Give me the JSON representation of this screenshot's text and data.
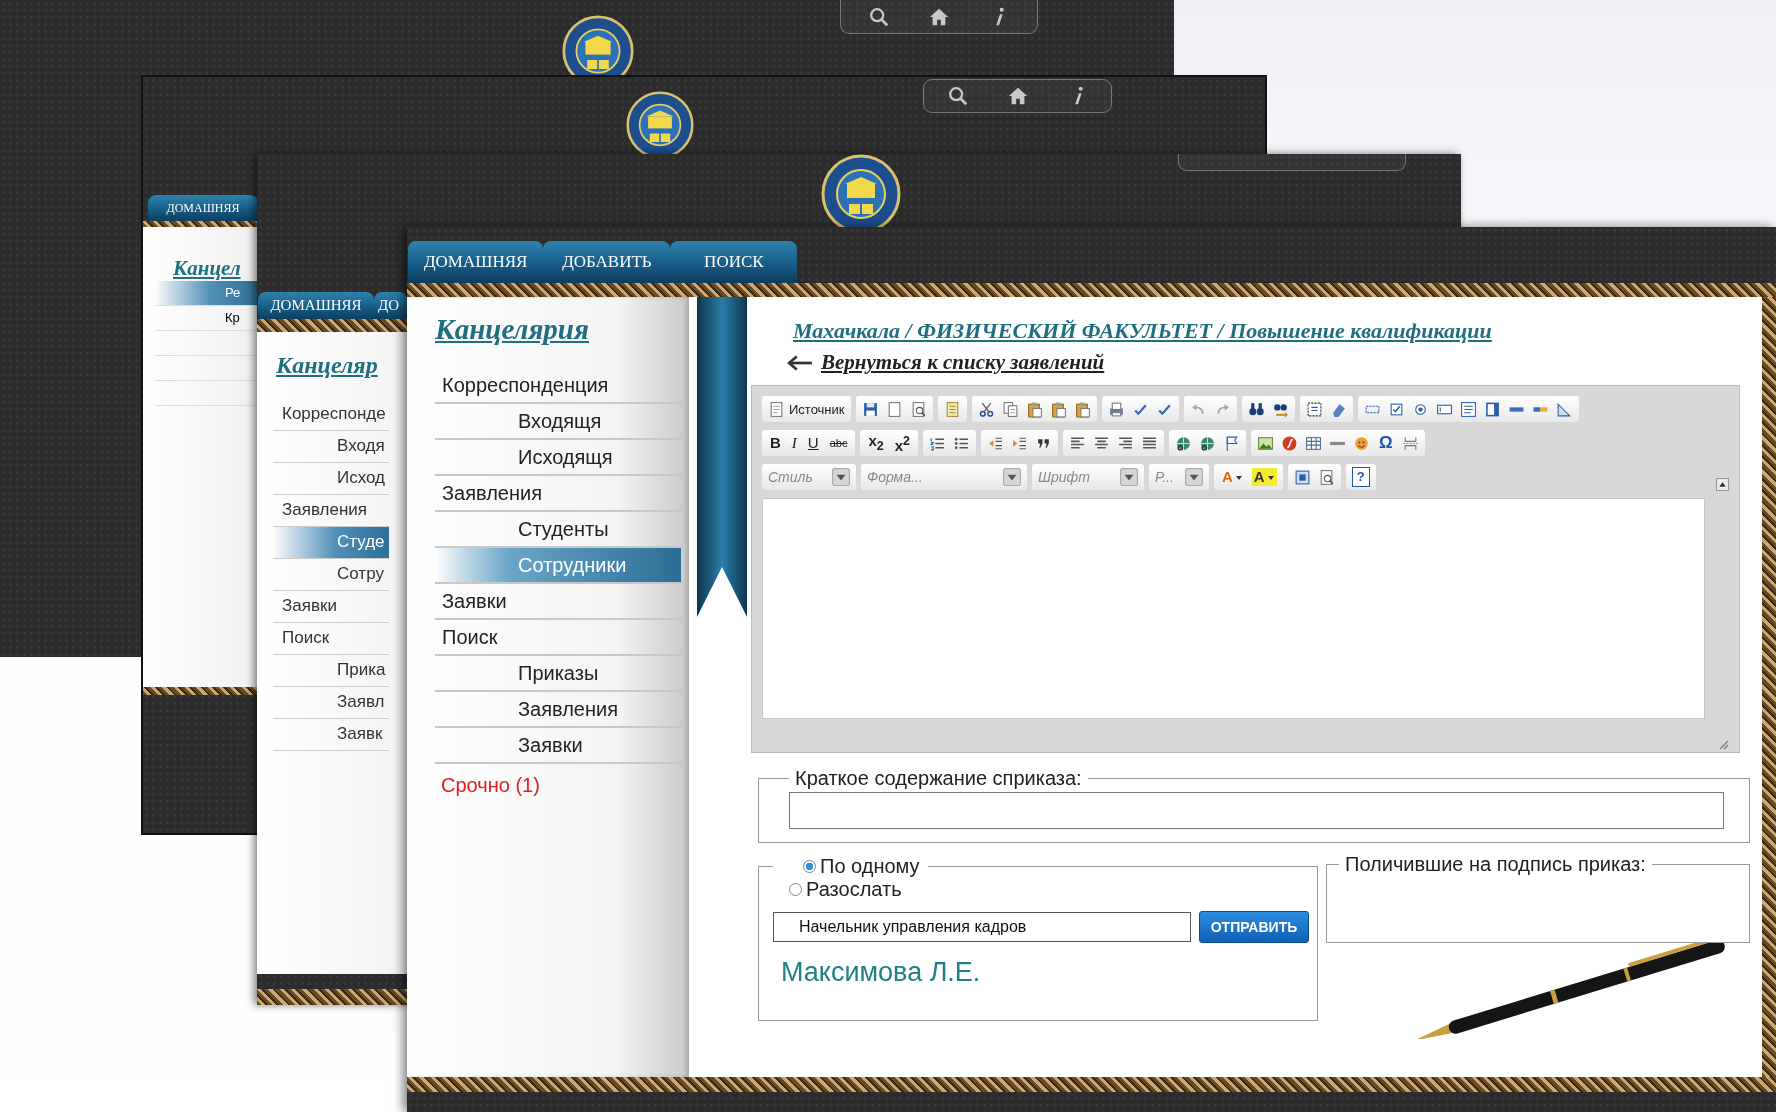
{
  "window_b": {
    "tabs": [
      {
        "label": "ДОМАШНЯЯ"
      }
    ],
    "sidebar": {
      "title": "Канцел",
      "items": [
        {
          "label": "Ре",
          "selected": true
        },
        {
          "label": "Кр",
          "selected": false
        }
      ]
    }
  },
  "window_c": {
    "tabs": [
      {
        "label": "ДОМАШНЯЯ"
      },
      {
        "label": "ДО"
      }
    ],
    "sidebar": {
      "title": "Канцеляр",
      "items": [
        {
          "label": "Корреспонде",
          "kind": "section",
          "selected": false
        },
        {
          "label": "Входя",
          "kind": "sub",
          "selected": false
        },
        {
          "label": "Исход",
          "kind": "sub",
          "selected": false
        },
        {
          "label": "Заявления",
          "kind": "section",
          "selected": false
        },
        {
          "label": "Студе",
          "kind": "sub",
          "selected": true
        },
        {
          "label": "Сотру",
          "kind": "sub",
          "selected": false
        },
        {
          "label": "Заявки",
          "kind": "section",
          "selected": false
        },
        {
          "label": "Поиск",
          "kind": "section",
          "selected": false
        },
        {
          "label": "Прика",
          "kind": "sub",
          "selected": false
        },
        {
          "label": "Заявл",
          "kind": "sub",
          "selected": false
        },
        {
          "label": "Заявк",
          "kind": "sub",
          "selected": false
        }
      ]
    }
  },
  "page": {
    "tabs": [
      {
        "label": "ДОМАШНЯЯ"
      },
      {
        "label": "ДОБАВИТЬ"
      },
      {
        "label": "ПОИСК"
      }
    ],
    "sidebar": {
      "title": "Канцелярия",
      "items": [
        {
          "label": "Корреспонденция",
          "kind": "section",
          "selected": false
        },
        {
          "label": "Входящя",
          "kind": "sub",
          "selected": false
        },
        {
          "label": "Исходящя",
          "kind": "sub",
          "selected": false
        },
        {
          "label": "Заявления",
          "kind": "section",
          "selected": false
        },
        {
          "label": "Студенты",
          "kind": "sub",
          "selected": false
        },
        {
          "label": "Сотрудники",
          "kind": "sub",
          "selected": true
        },
        {
          "label": "Заявки",
          "kind": "section",
          "selected": false
        },
        {
          "label": "Поиск",
          "kind": "section",
          "selected": false
        },
        {
          "label": "Приказы",
          "kind": "sub",
          "selected": false
        },
        {
          "label": "Заявления",
          "kind": "sub",
          "selected": false
        },
        {
          "label": "Заявки",
          "kind": "sub",
          "selected": false
        }
      ],
      "urgent": "Срочно (1)"
    },
    "breadcrumb": "Махачкала / ФИЗИЧЕСКИЙ ФАКУЛЬТЕТ / Повышение квалификации",
    "back_link": "Вернуться к списку заявлений",
    "editor": {
      "source_button": "Источник",
      "format_buttons": [
        "B",
        "I",
        "U",
        "abc"
      ],
      "script_buttons": [
        "x$_{2}$",
        "x$^{2}$"
      ],
      "special_char": "Ω",
      "combos": [
        {
          "label": "Стиль"
        },
        {
          "label": "Форма..."
        },
        {
          "label": "Шрифт"
        },
        {
          "label": "Р..."
        }
      ],
      "color_buttons": [
        "A",
        "A"
      ],
      "help": "?"
    },
    "summary": {
      "legend": "Краткое содержание сприказа:"
    },
    "send": {
      "options": [
        {
          "label": "По одному",
          "selected": true
        },
        {
          "label": "Разослать",
          "selected": false
        }
      ],
      "recipient": {
        "value": "Начельник управления кадров"
      },
      "send_button": "ОТПРАВИТЬ",
      "chosen_name": "Максимова Л.Е."
    },
    "received": {
      "legend": "Поличившие на подпись приказ:"
    }
  }
}
